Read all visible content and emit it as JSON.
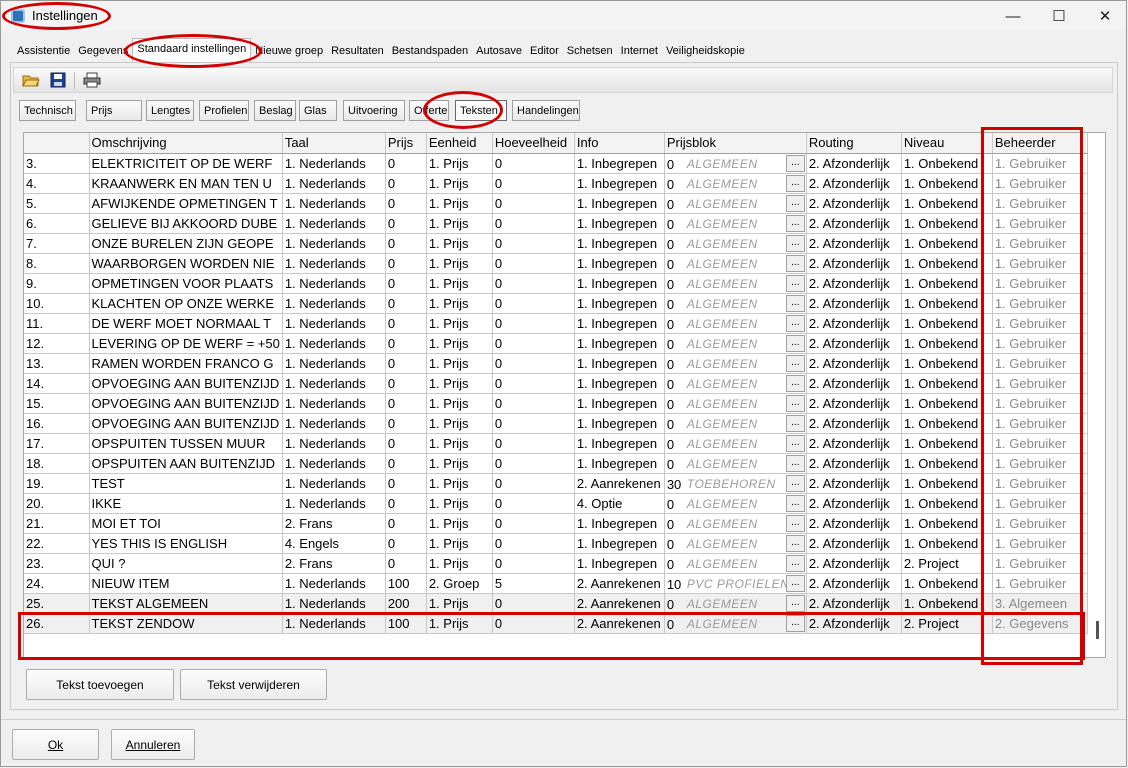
{
  "window": {
    "title": "Instellingen",
    "minimize": "—",
    "maximize": "☐",
    "close": "✕"
  },
  "tabs": [
    "Assistentie",
    "Gegevens",
    "Standaard instellingen",
    "Nieuwe groep",
    "Resultaten",
    "Bestandspaden",
    "Autosave",
    "Editor",
    "Schetsen",
    "Internet",
    "Veiligheidskopie"
  ],
  "active_tab": "Standaard instellingen",
  "toolbar": {
    "icons": [
      "open-folder-icon",
      "save-icon",
      "print-icon"
    ]
  },
  "subtabs": [
    "Technisch",
    "Prijs",
    "Lengtes",
    "Profielen",
    "Beslag",
    "Glas",
    "Uitvoering",
    "Offerte",
    "Teksten",
    "Handelingen"
  ],
  "active_subtab": "Teksten",
  "grid": {
    "columns": [
      "",
      "Omschrijving",
      "Taal",
      "Prijs",
      "Eenheid",
      "Hoeveelheid",
      "Info",
      "Prijsblok",
      "Routing",
      "Niveau",
      "Beheerder"
    ],
    "rows": [
      [
        "3.",
        "ELEKTRICITEIT OP DE WERF",
        "1. Nederlands",
        "0",
        "1. Prijs",
        "0",
        "1. Inbegrepen",
        "0",
        "ALGEMEEN",
        "2. Afzonderlijk",
        "1. Onbekend",
        "1. Gebruiker"
      ],
      [
        "4.",
        "KRAANWERK EN MAN TEN U",
        "1. Nederlands",
        "0",
        "1. Prijs",
        "0",
        "1. Inbegrepen",
        "0",
        "ALGEMEEN",
        "2. Afzonderlijk",
        "1. Onbekend",
        "1. Gebruiker"
      ],
      [
        "5.",
        "AFWIJKENDE OPMETINGEN T",
        "1. Nederlands",
        "0",
        "1. Prijs",
        "0",
        "1. Inbegrepen",
        "0",
        "ALGEMEEN",
        "2. Afzonderlijk",
        "1. Onbekend",
        "1. Gebruiker"
      ],
      [
        "6.",
        "GELIEVE BIJ AKKOORD DUBE",
        "1. Nederlands",
        "0",
        "1. Prijs",
        "0",
        "1. Inbegrepen",
        "0",
        "ALGEMEEN",
        "2. Afzonderlijk",
        "1. Onbekend",
        "1. Gebruiker"
      ],
      [
        "7.",
        "ONZE BURELEN ZIJN GEOPE",
        "1. Nederlands",
        "0",
        "1. Prijs",
        "0",
        "1. Inbegrepen",
        "0",
        "ALGEMEEN",
        "2. Afzonderlijk",
        "1. Onbekend",
        "1. Gebruiker"
      ],
      [
        "8.",
        "WAARBORGEN WORDEN NIE",
        "1. Nederlands",
        "0",
        "1. Prijs",
        "0",
        "1. Inbegrepen",
        "0",
        "ALGEMEEN",
        "2. Afzonderlijk",
        "1. Onbekend",
        "1. Gebruiker"
      ],
      [
        "9.",
        "OPMETINGEN VOOR PLAATS",
        "1. Nederlands",
        "0",
        "1. Prijs",
        "0",
        "1. Inbegrepen",
        "0",
        "ALGEMEEN",
        "2. Afzonderlijk",
        "1. Onbekend",
        "1. Gebruiker"
      ],
      [
        "10.",
        "KLACHTEN OP ONZE WERKE",
        "1. Nederlands",
        "0",
        "1. Prijs",
        "0",
        "1. Inbegrepen",
        "0",
        "ALGEMEEN",
        "2. Afzonderlijk",
        "1. Onbekend",
        "1. Gebruiker"
      ],
      [
        "11.",
        "DE WERF MOET NORMAAL T",
        "1. Nederlands",
        "0",
        "1. Prijs",
        "0",
        "1. Inbegrepen",
        "0",
        "ALGEMEEN",
        "2. Afzonderlijk",
        "1. Onbekend",
        "1. Gebruiker"
      ],
      [
        "12.",
        "LEVERING OP DE WERF = +50",
        "1. Nederlands",
        "0",
        "1. Prijs",
        "0",
        "1. Inbegrepen",
        "0",
        "ALGEMEEN",
        "2. Afzonderlijk",
        "1. Onbekend",
        "1. Gebruiker"
      ],
      [
        "13.",
        "RAMEN WORDEN FRANCO G",
        "1. Nederlands",
        "0",
        "1. Prijs",
        "0",
        "1. Inbegrepen",
        "0",
        "ALGEMEEN",
        "2. Afzonderlijk",
        "1. Onbekend",
        "1. Gebruiker"
      ],
      [
        "14.",
        "OPVOEGING AAN BUITENZIJD",
        "1. Nederlands",
        "0",
        "1. Prijs",
        "0",
        "1. Inbegrepen",
        "0",
        "ALGEMEEN",
        "2. Afzonderlijk",
        "1. Onbekend",
        "1. Gebruiker"
      ],
      [
        "15.",
        "OPVOEGING AAN BUITENZIJD",
        "1. Nederlands",
        "0",
        "1. Prijs",
        "0",
        "1. Inbegrepen",
        "0",
        "ALGEMEEN",
        "2. Afzonderlijk",
        "1. Onbekend",
        "1. Gebruiker"
      ],
      [
        "16.",
        "OPVOEGING AAN BUITENZIJD",
        "1. Nederlands",
        "0",
        "1. Prijs",
        "0",
        "1. Inbegrepen",
        "0",
        "ALGEMEEN",
        "2. Afzonderlijk",
        "1. Onbekend",
        "1. Gebruiker"
      ],
      [
        "17.",
        "OPSPUITEN TUSSEN MUUR",
        "1. Nederlands",
        "0",
        "1. Prijs",
        "0",
        "1. Inbegrepen",
        "0",
        "ALGEMEEN",
        "2. Afzonderlijk",
        "1. Onbekend",
        "1. Gebruiker"
      ],
      [
        "18.",
        "OPSPUITEN AAN BUITENZIJD",
        "1. Nederlands",
        "0",
        "1. Prijs",
        "0",
        "1. Inbegrepen",
        "0",
        "ALGEMEEN",
        "2. Afzonderlijk",
        "1. Onbekend",
        "1. Gebruiker"
      ],
      [
        "19.",
        "TEST",
        "1. Nederlands",
        "0",
        "1. Prijs",
        "0",
        "2. Aanrekenen",
        "30",
        "TOEBEHOREN",
        "2. Afzonderlijk",
        "1. Onbekend",
        "1. Gebruiker"
      ],
      [
        "20.",
        "IKKE",
        "1. Nederlands",
        "0",
        "1. Prijs",
        "0",
        "4. Optie",
        "0",
        "ALGEMEEN",
        "2. Afzonderlijk",
        "1. Onbekend",
        "1. Gebruiker"
      ],
      [
        "21.",
        "MOI ET TOI",
        "2. Frans",
        "0",
        "1. Prijs",
        "0",
        "1. Inbegrepen",
        "0",
        "ALGEMEEN",
        "2. Afzonderlijk",
        "1. Onbekend",
        "1. Gebruiker"
      ],
      [
        "22.",
        "YES THIS IS ENGLISH",
        "4. Engels",
        "0",
        "1. Prijs",
        "0",
        "1. Inbegrepen",
        "0",
        "ALGEMEEN",
        "2. Afzonderlijk",
        "1. Onbekend",
        "1. Gebruiker"
      ],
      [
        "23.",
        "QUI ?",
        "2. Frans",
        "0",
        "1. Prijs",
        "0",
        "1. Inbegrepen",
        "0",
        "ALGEMEEN",
        "2. Afzonderlijk",
        "2. Project",
        "1. Gebruiker"
      ],
      [
        "24.",
        "NIEUW ITEM",
        "1. Nederlands",
        "100",
        "2. Groep",
        "5",
        "2. Aanrekenen",
        "10",
        "PVC PROFIELEN",
        "2. Afzonderlijk",
        "1. Onbekend",
        "1. Gebruiker"
      ],
      [
        "25.",
        "TEKST ALGEMEEN",
        "1. Nederlands",
        "200",
        "1. Prijs",
        "0",
        "2. Aanrekenen",
        "0",
        "ALGEMEEN",
        "2. Afzonderlijk",
        "1. Onbekend",
        "3. Algemeen"
      ],
      [
        "26.",
        "TEKST ZENDOW",
        "1. Nederlands",
        "100",
        "1. Prijs",
        "0",
        "2. Aanrekenen",
        "0",
        "ALGEMEEN",
        "2. Afzonderlijk",
        "2. Project",
        "2. Gegevens"
      ]
    ],
    "ellipsis": "..."
  },
  "buttons": {
    "add_text": "Tekst toevoegen",
    "remove_text": "Tekst verwijderen",
    "ok": "Ok",
    "cancel": "Annuleren"
  },
  "annotation_color": "#d40000"
}
